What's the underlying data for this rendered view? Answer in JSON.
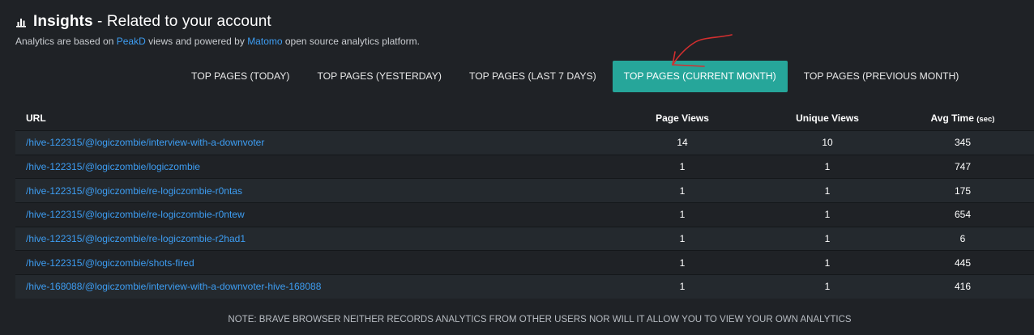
{
  "header": {
    "title_bold": "Insights",
    "title_rest": " - Related to your account",
    "subtitle_pre": "Analytics are based on ",
    "subtitle_link1": "PeakD",
    "subtitle_mid": " views and powered by ",
    "subtitle_link2": "Matomo",
    "subtitle_post": " open source analytics platform."
  },
  "tabs": [
    {
      "label": "TOP PAGES (TODAY)"
    },
    {
      "label": "TOP PAGES (YESTERDAY)"
    },
    {
      "label": "TOP PAGES (LAST 7 DAYS)"
    },
    {
      "label": "TOP PAGES (CURRENT MONTH)"
    },
    {
      "label": "TOP PAGES (PREVIOUS MONTH)"
    }
  ],
  "table": {
    "headers": {
      "url": "URL",
      "page_views": "Page Views",
      "unique_views": "Unique Views",
      "avg_time": "Avg Time",
      "avg_time_unit": "(sec)"
    },
    "rows": [
      {
        "url": "/hive-122315/@logiczombie/interview-with-a-downvoter",
        "page_views": "14",
        "unique_views": "10",
        "avg_time": "345"
      },
      {
        "url": "/hive-122315/@logiczombie/logiczombie",
        "page_views": "1",
        "unique_views": "1",
        "avg_time": "747"
      },
      {
        "url": "/hive-122315/@logiczombie/re-logiczombie-r0ntas",
        "page_views": "1",
        "unique_views": "1",
        "avg_time": "175"
      },
      {
        "url": "/hive-122315/@logiczombie/re-logiczombie-r0ntew",
        "page_views": "1",
        "unique_views": "1",
        "avg_time": "654"
      },
      {
        "url": "/hive-122315/@logiczombie/re-logiczombie-r2had1",
        "page_views": "1",
        "unique_views": "1",
        "avg_time": "6"
      },
      {
        "url": "/hive-122315/@logiczombie/shots-fired",
        "page_views": "1",
        "unique_views": "1",
        "avg_time": "445"
      },
      {
        "url": "/hive-168088/@logiczombie/interview-with-a-downvoter-hive-168088",
        "page_views": "1",
        "unique_views": "1",
        "avg_time": "416"
      }
    ]
  },
  "note": "NOTE: BRAVE BROWSER NEITHER RECORDS ANALYTICS FROM OTHER USERS NOR WILL IT ALLOW YOU TO VIEW YOUR OWN ANALYTICS",
  "colors": {
    "background": "#1f2226",
    "accent_tab": "#26a69a",
    "link": "#3d9df2",
    "annotation_arrow": "#d32f2f"
  }
}
